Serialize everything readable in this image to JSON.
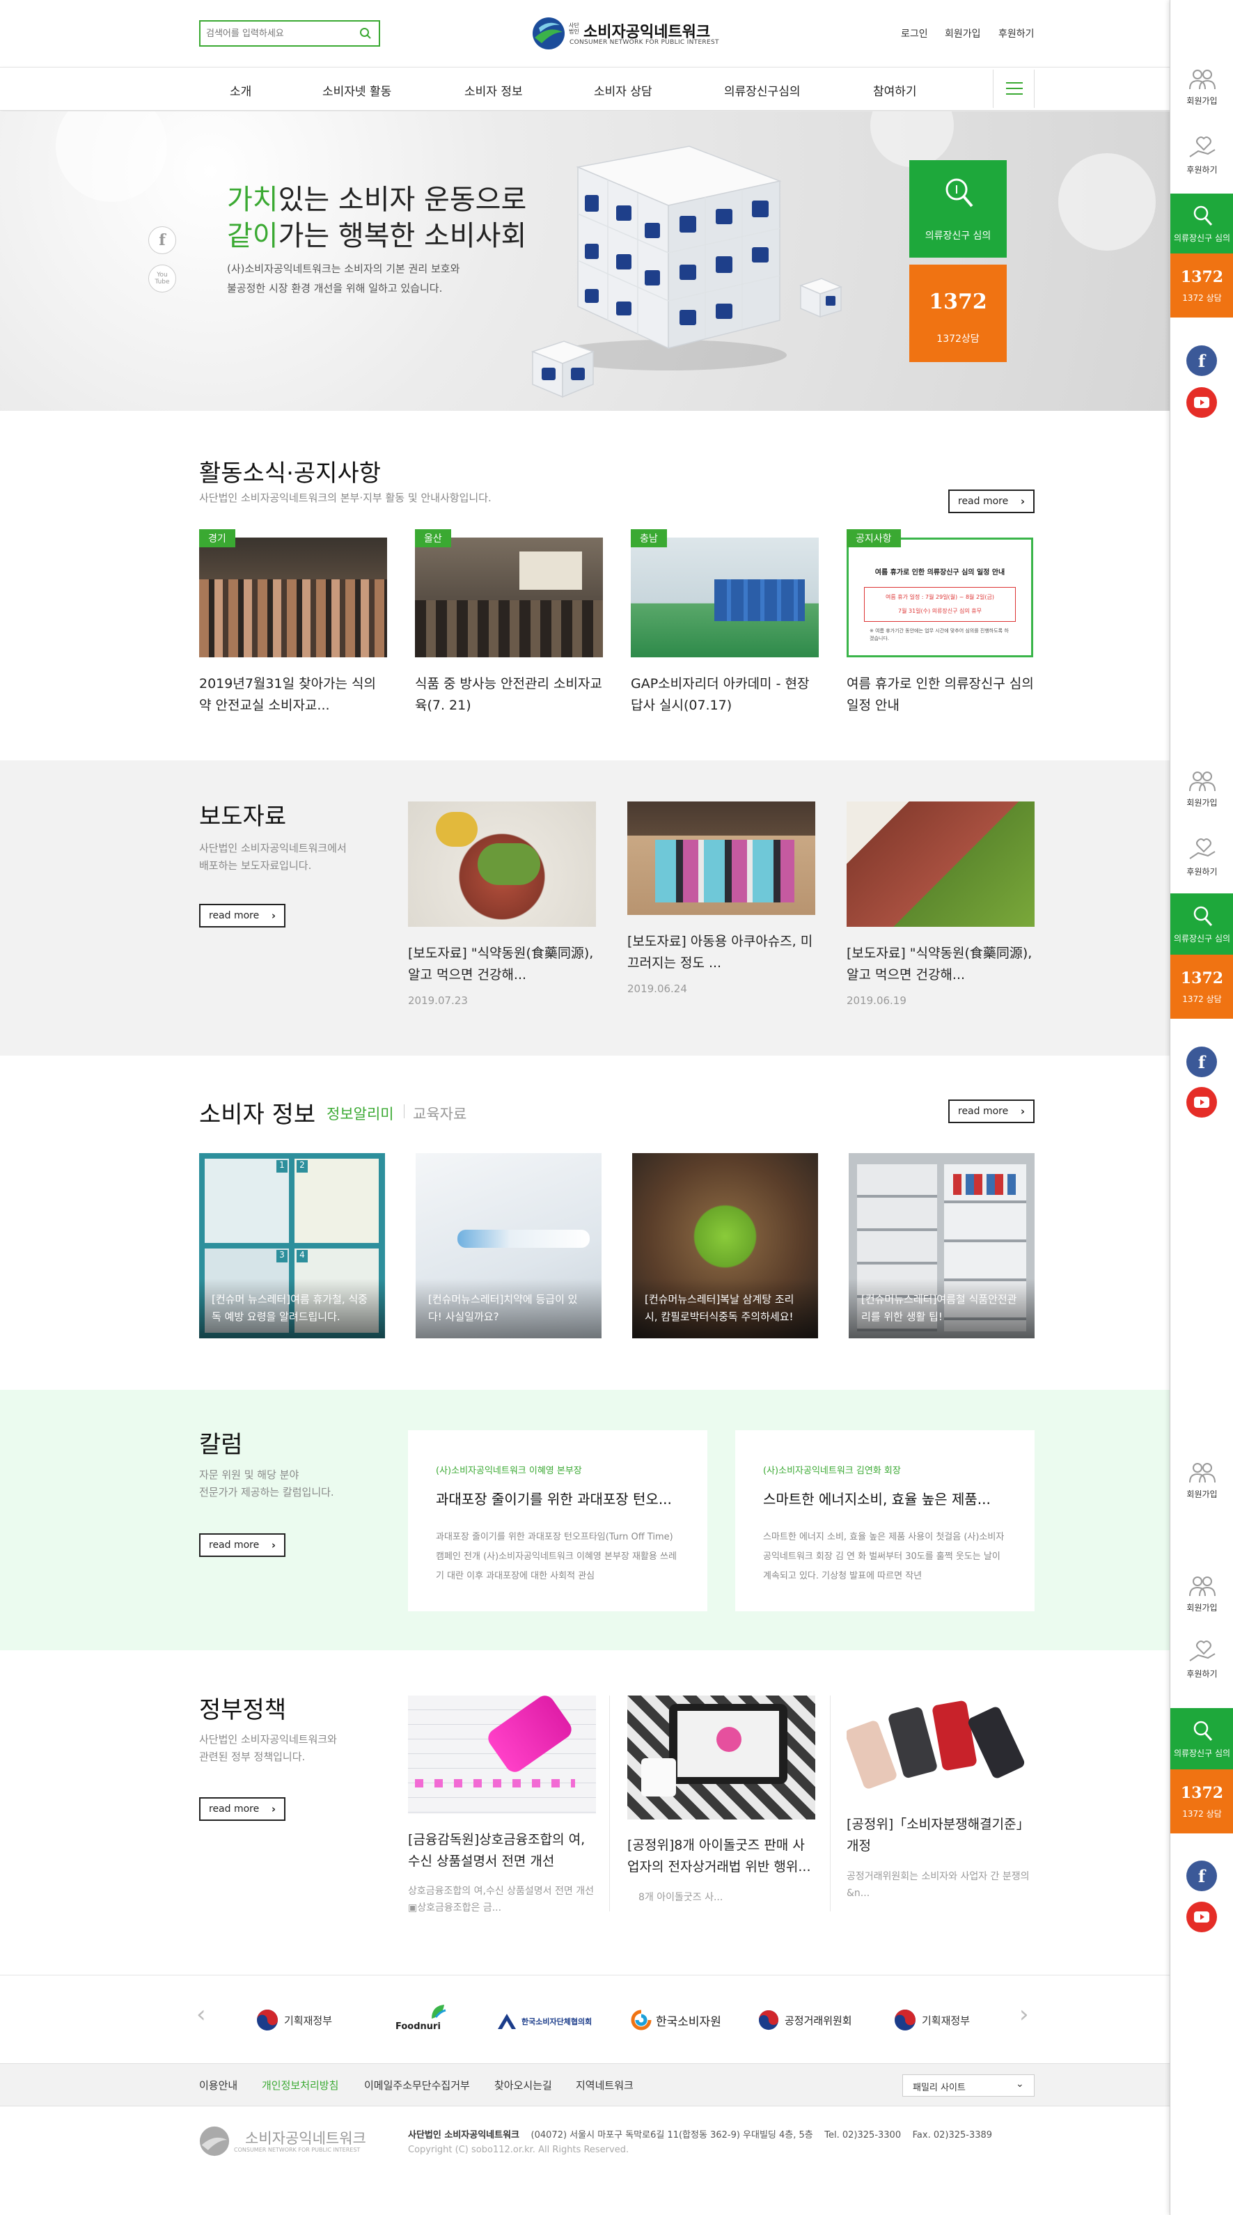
{
  "header": {
    "search_placeholder": "검색어를 입력하세요",
    "logo_name": "소비자공익네트워크",
    "logo_sub": "CONSUMER NETWORK FOR PUBLIC INTEREST",
    "logo_small": "사단 법인",
    "links": [
      "로그인",
      "회원가입",
      "후원하기"
    ]
  },
  "nav": {
    "items": [
      "소개",
      "소비자넷 활동",
      "소비자 정보",
      "소비자 상담",
      "의류장신구심의",
      "참여하기"
    ]
  },
  "hero": {
    "line1_accent": "가치",
    "line1_rest": "있는 소비자 운동으로",
    "line2_accent": "같이",
    "line2_rest": "가는 행복한 소비사회",
    "desc": "(사)소비자공익네트워크는 소비자의 기본 권리 보호와\n불공정한 시장 환경 개선을 위해 일하고 있습니다.",
    "btn_green": "의류장신구 심의",
    "btn_orange_num": "1372",
    "btn_orange": "1372상담",
    "youtube_small": "You Tube"
  },
  "news": {
    "title": "활동소식·공지사항",
    "sub": "사단법인 소비자공익네트워크의 본부·지부 활동 및 안내사항입니다.",
    "more": "read more",
    "items": [
      {
        "tag": "경기",
        "title": "2019년7월31일 찾아가는 식의약 안전교실 소비자교..."
      },
      {
        "tag": "울산",
        "title": "식품 중 방사능 안전관리 소비자교육(7. 21)"
      },
      {
        "tag": "충남",
        "title": "GAP소비자리더 아카데미 - 현장답사 실시(07.17)"
      },
      {
        "tag": "공지사항",
        "title": "여름 휴가로 인한 의류장신구 심의 일정 안내"
      }
    ],
    "notice_img": {
      "heading": "여름 휴가로 인한 의류장신구 심의 일정 안내",
      "line1": "여름 휴가 일정 : 7월 29일(월) ~ 8월 2일(금)",
      "line2": "7월 31일(수) 의류장신구 심의 휴무",
      "note": "※ 여름 휴가기간 동안에는 업무 시간에 맞추어 심의를 진행하도록 하겠습니다."
    }
  },
  "press": {
    "title": "보도자료",
    "sub": "사단법인 소비자공익네트워크에서\n배포하는 보도자료입니다.",
    "more": "read more",
    "items": [
      {
        "title": "[보도자료] \"식약동원(食藥同源), 알고 먹으면 건강해...",
        "date": "2019.07.23"
      },
      {
        "title": "[보도자료] 아동용 아쿠아슈즈, 미끄러지는 정도 ...",
        "date": "2019.06.24"
      },
      {
        "title": "[보도자료] \"식약동원(食藥同源), 알고 먹으면 건강해...",
        "date": "2019.06.19"
      }
    ]
  },
  "info": {
    "title": "소비자 정보",
    "tab_active": "정보알리미",
    "tab_other": "교육자료",
    "more": "read more",
    "items": [
      "[컨슈머 뉴스레터]여름 휴가철, 식중독 예방 요령을 알려드립니다.",
      "[컨슈머뉴스레터]치약에 등급이 있다! 사실일까요?",
      "[컨슈머뉴스레터]복날 삼계탕 조리시, 캄필로박터식중독 주의하세요!",
      "[컨슈머뉴스레터]여름철 식품안전관리를 위한 생활 팁!"
    ],
    "thumb_numbers": [
      "1",
      "2",
      "3",
      "4"
    ]
  },
  "column": {
    "title": "칼럼",
    "sub": "자문 위원 및 해당 분야\n전문가가 제공하는 칼럼입니다.",
    "more": "read more",
    "items": [
      {
        "author": "(사)소비자공익네트워크 이혜영 본부장",
        "title": "과대포장 줄이기를 위한 과대포장 턴오...",
        "body": "과대포장 줄이기를 위한 과대포장 턴오프타임(Turn Off Time) 캠페인 전개  (사)소비자공익네트워크 이혜영 본부장 재활용 쓰레기 대란 이후 과대포장에 대한 사회적 관심"
      },
      {
        "author": "(사)소비자공익네트워크 김연화 회장",
        "title": "스마트한 에너지소비, 효율 높은 제품...",
        "body": "스마트한 에너지 소비, 효율 높은 제품 사용이 첫걸음  (사)소비자공익네트워크 회장 김 연 화   벌써부터 30도를 훌쩍 웃도는 날이 계속되고 있다. 기상청 발표에 따르면 작년"
      }
    ]
  },
  "policy": {
    "title": "정부정책",
    "sub": "사단법인 소비자공익네트워크와\n관련된 정부 정책입니다.",
    "more": "read more",
    "items": [
      {
        "title": "[금융감독원]상호금융조합의 여,수신 상품설명서 전면 개선",
        "body": "상호금융조합의 여,수신 상품설명서 전면 개선 ▣상호금융조합은 금..."
      },
      {
        "title": "[공정위]8개 아이돌굿즈 판매 사업자의 전자상거래법 위반 행위...",
        "body": "8개 아이돌굿즈 사..."
      },
      {
        "title": "[공정위]「소비자분쟁해결기준」 개정",
        "body": "공정거래위원회는 소비자와 사업자 간 분쟁의&n..."
      }
    ]
  },
  "partners": [
    "기획재정부",
    "Foodnuri",
    "한국소비자단체협의회",
    "한국소비자원",
    "공정거래위원회",
    "기획재정부"
  ],
  "footer_links": [
    "이용안내",
    "개인정보처리방침",
    "이메일주소무단수집거부",
    "찾아오시는길",
    "지역네트워크"
  ],
  "family_site": "패밀리 사이트",
  "footer": {
    "org": "사단법인 소비자공익네트워크",
    "address": "(04072) 서울시 마포구 독막로6길 11(합정동 362-9) 우대빌딩 4층, 5층",
    "tel": "Tel. 02)325-3300",
    "fax": "Fax. 02)325-3389",
    "copyright": "Copyright (C) sobo112.or.kr. All Rights Reserved.",
    "logo_name": "소비자공익네트워크",
    "logo_sub": "CONSUMER NETWORK FOR PUBLIC INTEREST"
  },
  "sidebar": {
    "join": "회원가입",
    "donate": "후원하기",
    "review": "의류장신구 심의",
    "call_num": "1372",
    "call": "1372 상담"
  },
  "colors": {
    "green": "#1ea83b",
    "orange": "#f07312",
    "accent_text": "#3aa932",
    "column_bg": "#ebfbef",
    "gray_bg": "#f2f2f2"
  }
}
